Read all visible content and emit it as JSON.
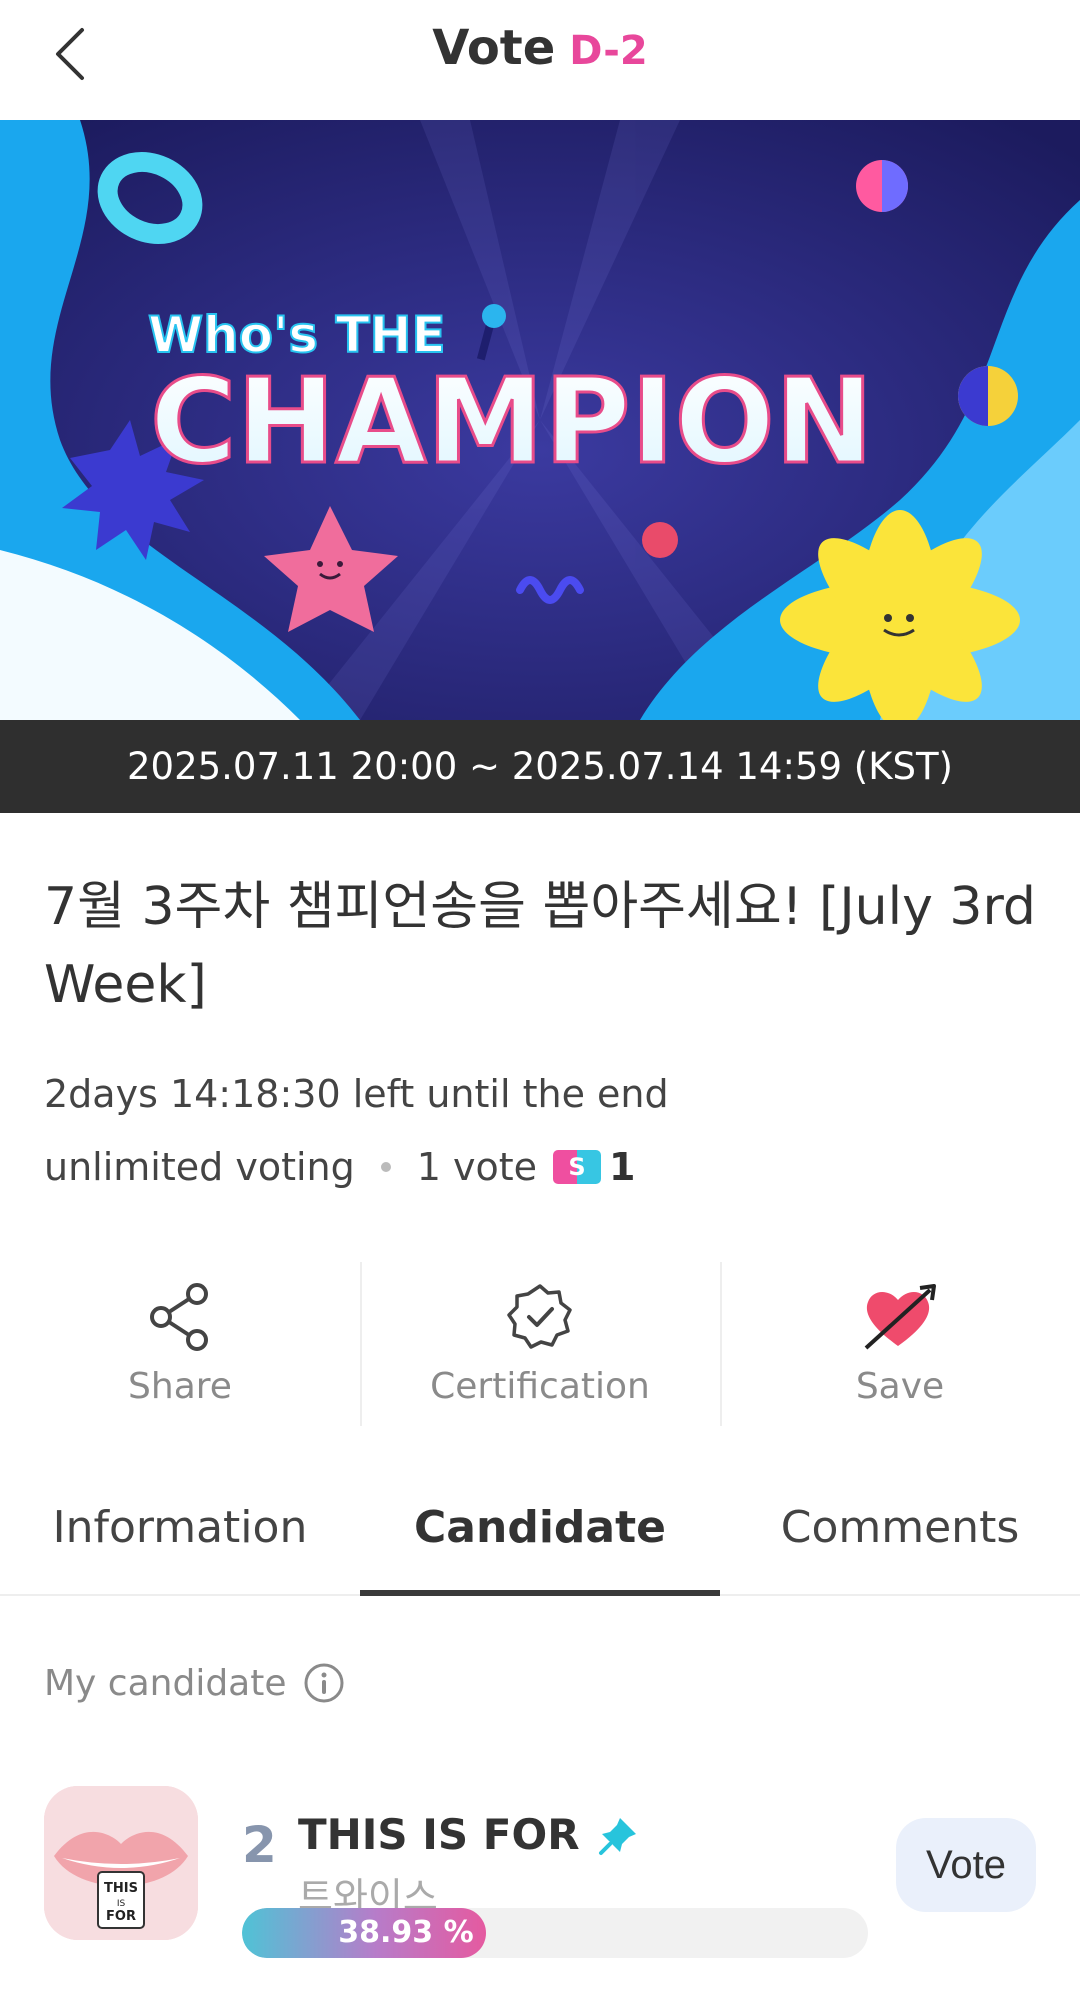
{
  "header": {
    "title": "Vote",
    "dday": "D-2"
  },
  "banner": {
    "line1": "Who's THE",
    "line2": "CHAMPION"
  },
  "date_range": "2025.07.11 20:00 ~ 2025.07.14 14:59 (KST)",
  "vote_title": "7월 3주차 챔피언송을 뽑아주세요! [July 3rd Week]",
  "countdown": "2days 14:18:30 left until the end",
  "meta": {
    "voting_type": "unlimited voting",
    "vote_unit": "1 vote",
    "ticket_icon": "star-ticket-icon",
    "cost": "1"
  },
  "actions": [
    {
      "label": "Share",
      "icon": "share-icon"
    },
    {
      "label": "Certification",
      "icon": "certification-badge-icon"
    },
    {
      "label": "Save",
      "icon": "heart-arrow-icon"
    }
  ],
  "tabs": [
    {
      "label": "Information",
      "active": false
    },
    {
      "label": "Candidate",
      "active": true
    },
    {
      "label": "Comments",
      "active": false
    }
  ],
  "section_label": "My candidate",
  "candidate": {
    "rank": "2",
    "song": "THIS IS FOR",
    "artist": "트와이스",
    "percent_text": "38.93 %",
    "percent": 38.93,
    "vote_label": "Vote"
  },
  "colors": {
    "accent_pink": "#e8479b",
    "date_strip": "#2f2f2f",
    "vote_button_bg": "#eaf0fb"
  }
}
